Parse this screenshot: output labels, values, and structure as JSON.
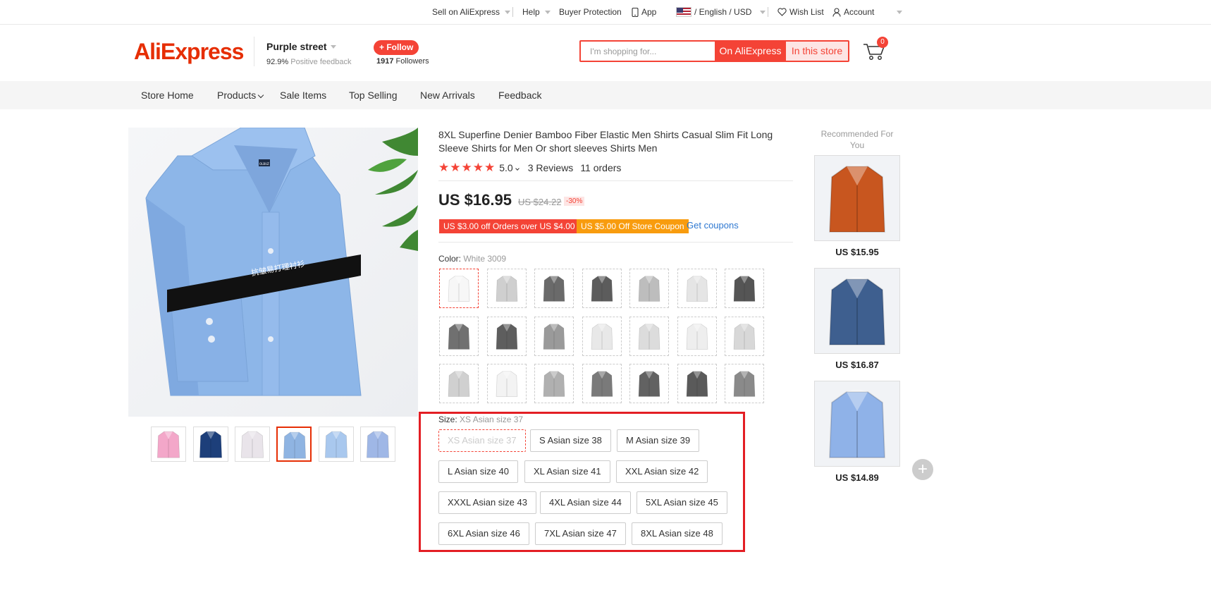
{
  "topbar": {
    "sell": "Sell on AliExpress",
    "help": "Help",
    "buyer_protection": "Buyer Protection",
    "app": "App",
    "lang_currency": "/ English /  USD",
    "wishlist": "Wish List",
    "account": "Account"
  },
  "header": {
    "logo": "AliExpress",
    "store_name": "Purple street",
    "feedback_pct": "92.9%",
    "feedback_label": "Positive feedback",
    "follow": "+ Follow",
    "followers_count": "1917",
    "followers_label": "Followers",
    "search_placeholder": "I'm shopping for...",
    "search_ali": "On AliExpress",
    "search_store": "In this store",
    "cart_count": "0"
  },
  "nav": {
    "items": [
      "Store Home",
      "Products",
      "Sale Items",
      "Top Selling",
      "New Arrivals",
      "Feedback"
    ]
  },
  "product": {
    "title": "8XL Superfine Denier Bamboo Fiber Elastic Men Shirts Casual Slim Fit Long Sleeve Shirts for Men Or short sleeves Shirts Men",
    "rating": "5.0",
    "reviews": "3 Reviews",
    "orders": "11 orders",
    "price": "US $16.95",
    "old_price": "US $24.22",
    "discount": "-30%",
    "coupon1": "US $3.00 off Orders over US $4.00",
    "coupon2": "US $5.00 Off Store Coupon",
    "get_coupons": "Get coupons",
    "color_label": "Color:",
    "color_value": "White 3009",
    "swatch_shades": [
      "#f7f7f7",
      "#cfcfcf",
      "#6a6a6a",
      "#5c5c5c",
      "#bdbdbd",
      "#e5e5e5",
      "#555555",
      "#707070",
      "#5e5e5e",
      "#9a9a9a",
      "#e8e8e8",
      "#dcdcdc",
      "#eeeeee",
      "#d8d8d8",
      "#d0d0d0",
      "#f3f3f3",
      "#b0b0b0",
      "#7a7a7a",
      "#626262",
      "#5a5a5a",
      "#8a8a8a"
    ],
    "size_label": "Size:",
    "size_value": "XS Asian size 37",
    "sizes": [
      "XS Asian size 37",
      "S Asian size 38",
      "M Asian size 39",
      "L Asian size 40",
      "XL Asian size 41",
      "XXL Asian size 42",
      "XXXL Asian size 43",
      "4XL Asian size 44",
      "5XL Asian size 45",
      "6XL Asian size 46",
      "7XL Asian size 47",
      "8XL Asian size 48"
    ]
  },
  "gallery": {
    "band_text": "抗皱易打理衬衫",
    "collar_label": "OLBUZ",
    "thumb_colors": [
      "#f3a7c9",
      "#1d3f7a",
      "#e9e4ea",
      "#8fb4e2",
      "#a9c8ee",
      "#9fb7e6"
    ]
  },
  "recommended": {
    "title": "Recommended For You",
    "items": [
      {
        "price": "US $15.95",
        "color": "#c8561f"
      },
      {
        "price": "US $16.87",
        "color": "#3e5f8f"
      },
      {
        "price": "US $14.89",
        "color": "#8fb2e8"
      }
    ],
    "add": "+"
  }
}
